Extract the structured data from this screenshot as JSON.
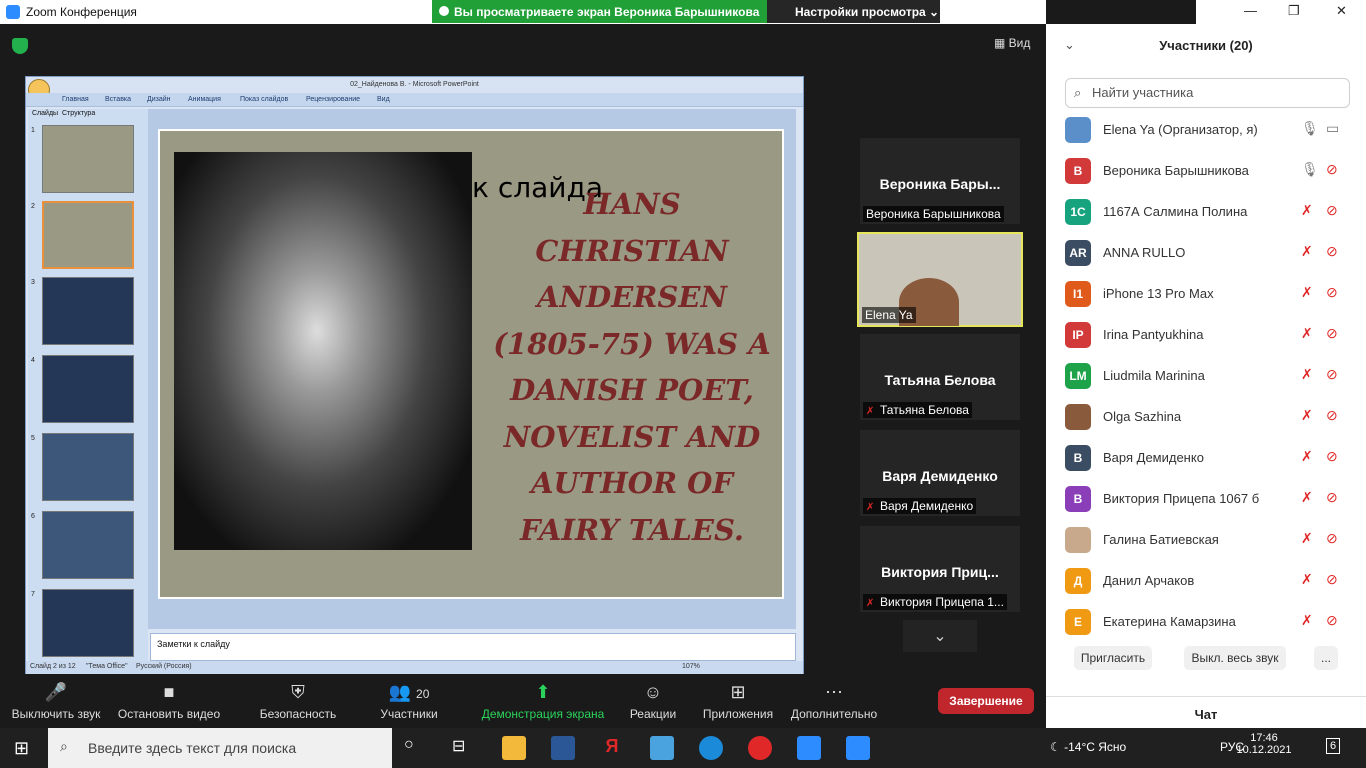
{
  "window": {
    "title": "Zoom Конференция"
  },
  "banner": {
    "text": "Вы просматриваете экран Вероника Барышникова",
    "view_options": "Настройки просмотра"
  },
  "view_button": "Вид",
  "ppt": {
    "window_title": "02_Найденова В. - Microsoft PowerPoint",
    "ribbon_tabs": [
      "Главная",
      "Вставка",
      "Дизайн",
      "Анимация",
      "Показ слайдов",
      "Рецензирование",
      "Вид"
    ],
    "panel_tabs": [
      "Слайды",
      "Структура"
    ],
    "slide_numbers": [
      "1",
      "2",
      "3",
      "4",
      "5",
      "6",
      "7"
    ],
    "placeholder": "к слайда",
    "slide_text": "Hans Christian Andersen (1805-75) was a Danish poet, novelist and author of fairy tales.",
    "notes": "Заметки к слайду",
    "status": [
      "Слайд 2 из 12",
      "\"Тема Office\"",
      "Русский (Россия)",
      "107%"
    ]
  },
  "tiles": [
    {
      "name": "Вероника  Бары...",
      "label": "Вероника Барышникова",
      "muted": false
    },
    {
      "name": "",
      "label": "Elena Ya",
      "muted": false
    },
    {
      "name": "Татьяна Белова",
      "label": "Татьяна Белова",
      "muted": true
    },
    {
      "name": "Варя Демиденко",
      "label": "Варя Демиденко",
      "muted": true
    },
    {
      "name": "Виктория  Приц...",
      "label": "Виктория Прицепа 1...",
      "muted": true
    }
  ],
  "toolbar": {
    "mute": "Выключить звук",
    "video": "Остановить видео",
    "security": "Безопасность",
    "participants": "Участники",
    "participants_count": "20",
    "share": "Демонстрация экрана",
    "reactions": "Реакции",
    "apps": "Приложения",
    "more": "Дополнительно",
    "end": "Завершение"
  },
  "participants_panel": {
    "title": "Участники (20)",
    "search_placeholder": "Найти участника",
    "invite": "Пригласить",
    "mute_all": "Выкл. весь звук",
    "more": "...",
    "chat": "Чат",
    "list": [
      {
        "initials": "",
        "name": "Elena Ya (Организатор, я)",
        "color": "#5b8fc9"
      },
      {
        "initials": "В",
        "name": "Вероника Барышникова",
        "color": "#d23a3a"
      },
      {
        "initials": "1С",
        "name": "1167А Салмина Полина",
        "color": "#16a37e"
      },
      {
        "initials": "AR",
        "name": "ANNA RULLO",
        "color": "#3b4d62"
      },
      {
        "initials": "I1",
        "name": "iPhone 13 Pro Max",
        "color": "#e05a1c"
      },
      {
        "initials": "IP",
        "name": "Irina Pantyukhina",
        "color": "#d23a3a"
      },
      {
        "initials": "LM",
        "name": "Liudmila Marinina",
        "color": "#1fa34a"
      },
      {
        "initials": "",
        "name": "Olga Sazhina",
        "color": "#8a5a3c"
      },
      {
        "initials": "В",
        "name": "Варя Демиденко",
        "color": "#3b4d62"
      },
      {
        "initials": "В",
        "name": "Виктория Прицепа 1067 б",
        "color": "#8a3fb8"
      },
      {
        "initials": "",
        "name": "Галина Батиевская",
        "color": "#c9a98c"
      },
      {
        "initials": "Д",
        "name": "Данил Арчаков",
        "color": "#f09a14"
      },
      {
        "initials": "Е",
        "name": "Екатерина Камарзина",
        "color": "#f09a14"
      }
    ]
  },
  "taskbar": {
    "search_placeholder": "Введите здесь текст для поиска",
    "weather": "-14°C  Ясно",
    "lang": "РУС",
    "time": "17:46",
    "date": "10.12.2021",
    "notifications": "6"
  }
}
